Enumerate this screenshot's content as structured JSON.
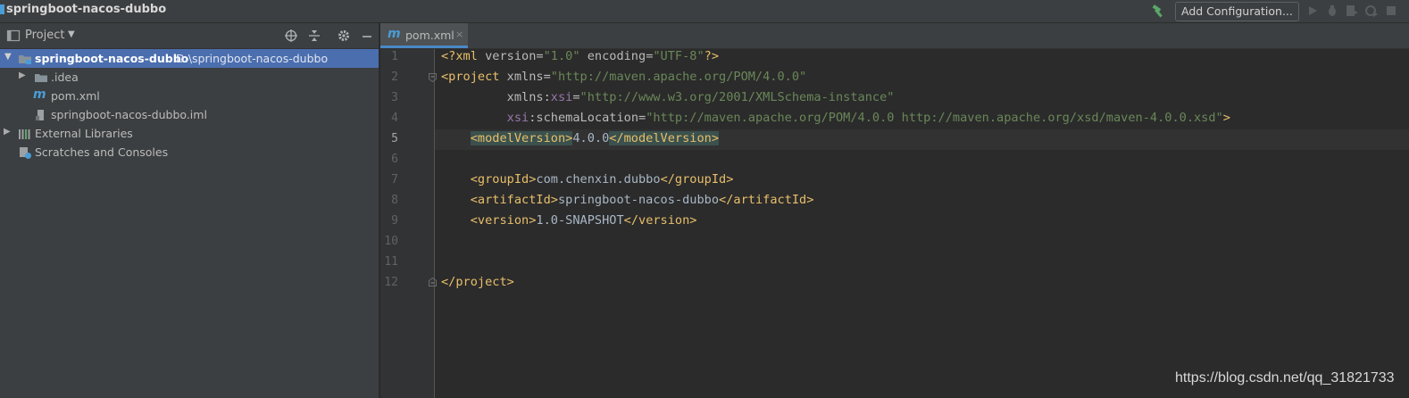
{
  "window": {
    "title": "springboot-nacos-dubbo"
  },
  "toolbar": {
    "add_configuration": "Add Configuration..."
  },
  "project_panel": {
    "title": "Project",
    "tree": [
      {
        "label": "springboot-nacos-dubbo",
        "path": "D:\\springboot-nacos-dubbo",
        "icon": "module-folder-icon",
        "expanded": true,
        "selected": true
      },
      {
        "label": ".idea",
        "icon": "folder-icon",
        "expanded": false
      },
      {
        "label": "pom.xml",
        "icon": "maven-icon"
      },
      {
        "label": "springboot-nacos-dubbo.iml",
        "icon": "file-icon"
      },
      {
        "label": "External Libraries",
        "icon": "library-icon",
        "expanded": false
      },
      {
        "label": "Scratches and Consoles",
        "icon": "scratches-icon"
      }
    ]
  },
  "editor": {
    "tab": {
      "label": "pom.xml",
      "close": "×"
    },
    "current_line": 5,
    "line_numbers": [
      "1",
      "2",
      "3",
      "4",
      "5",
      "6",
      "7",
      "8",
      "9",
      "10",
      "11",
      "12"
    ],
    "lines": {
      "l1": {
        "p1": "<?xml ",
        "a1": "version",
        "e1": "=",
        "v1": "\"1.0\"",
        "s1": " ",
        "a2": "encoding",
        "e2": "=",
        "v2": "\"UTF-8\"",
        "p2": "?>"
      },
      "l2": {
        "t1": "<project ",
        "a1": "xmlns",
        "e1": "=",
        "v1": "\"http://maven.apache.org/POM/4.0.0\""
      },
      "l3": {
        "a1": "xmlns",
        "c1": ":",
        "ns": "xsi",
        "e1": "=",
        "v1": "\"http://www.w3.org/2001/XMLSchema-instance\""
      },
      "l4": {
        "ns": "xsi",
        "c1": ":",
        "a1": "schemaLocation",
        "e1": "=",
        "v1": "\"http://maven.apache.org/POM/4.0.0 http://maven.apache.org/xsd/maven-4.0.0.xsd\"",
        "t1": ">"
      },
      "l5": {
        "t1": "<modelVersion>",
        "text": "4.0.0",
        "t2": "</modelVersion>"
      },
      "l7": {
        "t1": "<groupId>",
        "text": "com.chenxin.dubbo",
        "t2": "</groupId>"
      },
      "l8": {
        "t1": "<artifactId>",
        "text": "springboot-nacos-dubbo",
        "t2": "</artifactId>"
      },
      "l9": {
        "t1": "<version>",
        "text": "1.0-SNAPSHOT",
        "t2": "</version>"
      },
      "l12": {
        "t1": "</project>"
      }
    }
  },
  "watermark": "https://blog.csdn.net/qq_31821733",
  "colors": {
    "accent": "#4b6eaf",
    "tag": "#e8bf6a",
    "attr_value": "#6a8759",
    "namespace": "#9876aa",
    "background": "#2b2b2b",
    "panel": "#3c3f41"
  }
}
